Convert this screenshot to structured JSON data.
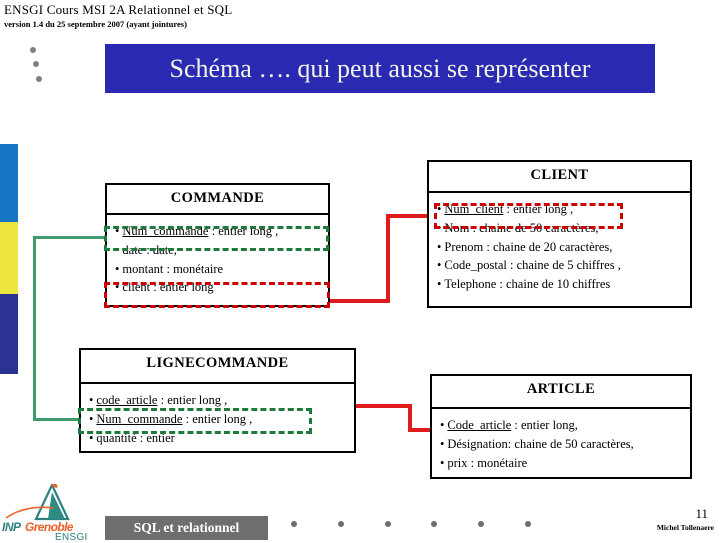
{
  "header": {
    "course_title": "ENSGI Cours MSI 2A Relationnel et SQL",
    "version_line": "version 1.4  du 25 septembre 2007 (ayant jointures)"
  },
  "banner": {
    "title": "Schéma …. qui peut aussi se représenter",
    "bg_color": "#2929b2",
    "text_color": "#f3f3e8"
  },
  "rail": {
    "blue": "#1874c4",
    "yellow": "#ede63c",
    "navy": "#2b3392"
  },
  "entities": {
    "commande": {
      "name": "COMMANDE",
      "attributes": [
        "Num_commande : entier long ,",
        "date : date,",
        "montant : monétaire",
        "client : entier long"
      ],
      "key_parts": [
        "Num_commande",
        "",
        "",
        ""
      ],
      "rest_parts": [
        " : entier long ,",
        "date : date,",
        "montant : monétaire",
        "client : entier long"
      ]
    },
    "client": {
      "name": "CLIENT",
      "attributes": [
        "Num_client : entier long ,",
        "Nom : chaine de 50 caractères,",
        "Prenom : chaine de 20 caractères,",
        "Code_postal : chaine de 5 chiffres ,",
        "Telephone : chaine de 10 chiffres"
      ],
      "key_parts": [
        "Num_client",
        "",
        "",
        "",
        ""
      ],
      "rest_parts": [
        " : entier long ,",
        "Nom : chaine de 50 caractères,",
        "Prenom : chaine de 20 caractères,",
        "Code_postal : chaine de 5 chiffres ,",
        "Telephone : chaine de 10 chiffres"
      ]
    },
    "lignecommande": {
      "name": "LIGNECOMMANDE",
      "attributes": [
        "code_article : entier long ,",
        "Num_commande : entier long ,",
        "quantité : entier"
      ],
      "key_parts": [
        "code_article",
        "Num_commande",
        ""
      ],
      "rest_parts": [
        " : entier long ,",
        " : entier long ,",
        "quantité : entier"
      ]
    },
    "article": {
      "name": "ARTICLE",
      "attributes": [
        "Code_article : entier long,",
        "Désignation: chaine de 50 caractères,",
        "prix : monétaire"
      ],
      "key_parts": [
        "Code_article",
        "",
        ""
      ],
      "rest_parts": [
        " : entier long,",
        "Désignation: chaine de 50 caractères,",
        "prix : monétaire"
      ]
    }
  },
  "highlights": {
    "green_color": "#1d7a3c",
    "red_color": "#cc0000"
  },
  "connectors": {
    "green_color": "#3f9b6d",
    "red_color": "#e01b1b"
  },
  "footer": {
    "bar_label": "SQL et relationnel",
    "bar_color": "#6e6e6e",
    "page_number": "11",
    "author": "Michel Tollenaere",
    "bullet": "•"
  },
  "logo": {
    "inp": "INP",
    "grenoble": "Grenoble",
    "ensgi": "ENSGI",
    "teal": "#2e7f7f",
    "orange": "#e8622a"
  }
}
